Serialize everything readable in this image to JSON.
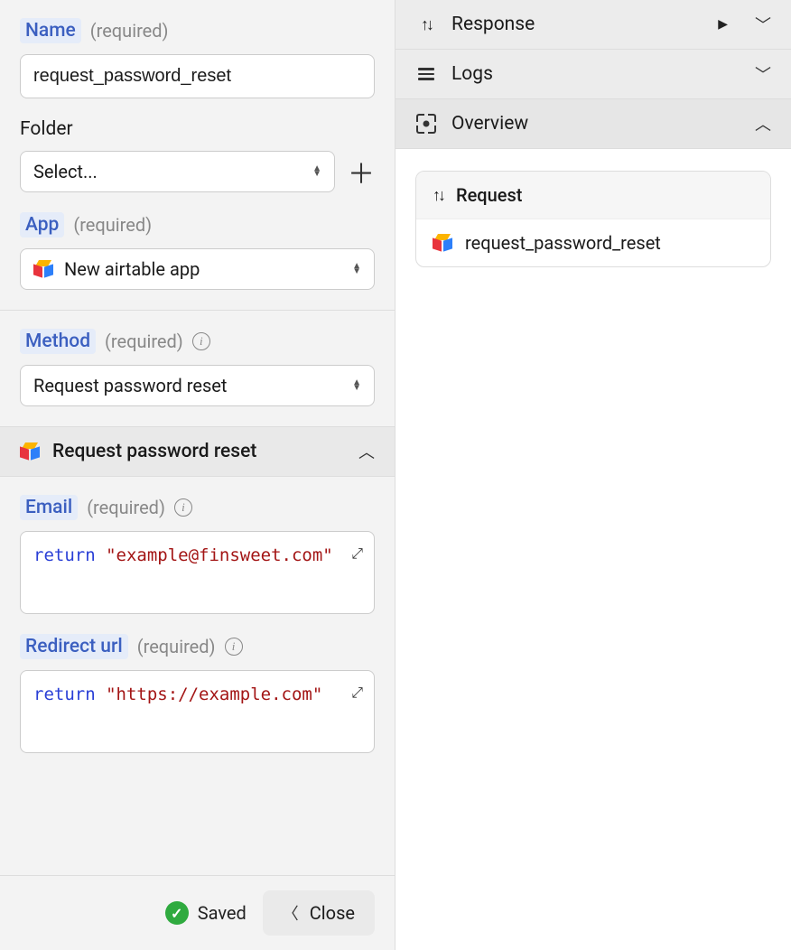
{
  "left": {
    "name": {
      "label": "Name",
      "required": "(required)",
      "value": "request_password_reset"
    },
    "folder": {
      "label": "Folder",
      "placeholder": "Select..."
    },
    "app": {
      "label": "App",
      "required": "(required)",
      "value": "New airtable app"
    },
    "method": {
      "label": "Method",
      "required": "(required)",
      "value": "Request password reset"
    },
    "accordion": {
      "title": "Request password reset"
    },
    "email": {
      "label": "Email",
      "required": "(required)",
      "code_kw": "return",
      "code_str": "\"example@finsweet.com\""
    },
    "redirect": {
      "label": "Redirect url",
      "required": "(required)",
      "code_kw": "return",
      "code_str": "\"https://example.com\""
    },
    "footer": {
      "saved": "Saved",
      "close": "Close"
    }
  },
  "right": {
    "rows": {
      "response": "Response",
      "logs": "Logs",
      "overview": "Overview"
    },
    "card": {
      "header": "Request",
      "item": "request_password_reset"
    }
  }
}
